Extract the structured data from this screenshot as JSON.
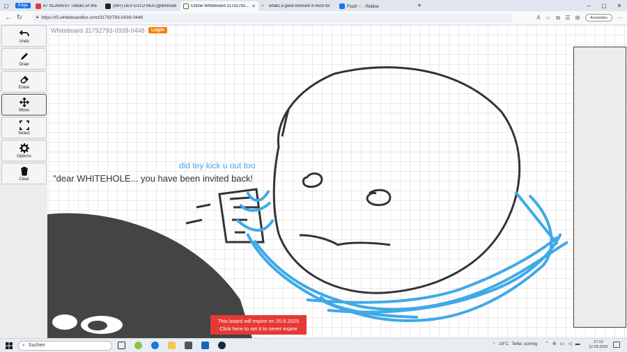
{
  "browser": {
    "edge_label": "Edge",
    "tabs": [
      {
        "label": "67 SCARIEST Tiktoks on the",
        "icon_color": "#e53935"
      },
      {
        "label": "(99+) DEV ESTO REA (@tehnoob",
        "icon_color": "#222222"
      },
      {
        "label": "Online Whiteboard 31792793-09",
        "icon_color": "#2e7d32"
      },
      {
        "label": "whats a good enchant in fisch for",
        "icon_color": "#555555"
      },
      {
        "label": "Fisch🐚 - Roblox",
        "icon_color": "#1a73e8"
      }
    ],
    "url": "https://r5.whiteboardfox.com/31792793-0939-0448",
    "sign_in_label": "Anmelden"
  },
  "whiteboard": {
    "title": "Whiteboard 31792793-0939-0448",
    "login_label": "Login",
    "tools": [
      {
        "label": "Undo",
        "icon": "undo-icon"
      },
      {
        "label": "Draw",
        "icon": "pencil-icon"
      },
      {
        "label": "Erase",
        "icon": "eraser-icon"
      },
      {
        "label": "Move",
        "icon": "move-icon"
      },
      {
        "label": "Select",
        "icon": "select-icon"
      },
      {
        "label": "Options",
        "icon": "gear-icon"
      },
      {
        "label": "Clear",
        "icon": "trash-icon"
      }
    ],
    "active_tool": "Move",
    "canvas_text_blue": "did tey kick u out too",
    "canvas_text_dark": "\"dear WHITEHOLE... you have been invited back!",
    "expire_line1": "This board will expire on 20.9.2025",
    "expire_line2": "Click here to set it to never expire",
    "colors": {
      "accent_orange": "#f57c00",
      "ink_blue": "#3fa9e8",
      "ink_dark": "#333333",
      "alert_red": "#e53935"
    }
  },
  "taskbar": {
    "search_label": "Suchen",
    "temperature": "19°C",
    "weather_text": "Teilw. sonnig",
    "time": "17:10",
    "date": "12.09.2025"
  }
}
